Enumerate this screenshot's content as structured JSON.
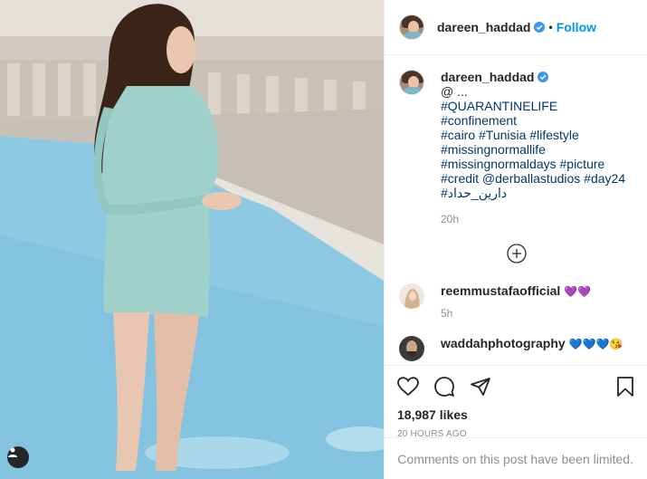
{
  "post": {
    "username": "dareen_haddad",
    "follow_label": "Follow",
    "separator": "•"
  },
  "caption": {
    "username": "dareen_haddad",
    "lines": [
      {
        "text": "@ ...",
        "hashtag": false
      },
      {
        "text": "#QUARANTINELIFE #confinement",
        "hashtag": true
      },
      {
        "text": "#cairo #Tunisia #lifestyle",
        "hashtag": true
      },
      {
        "text": "#missingnormallife",
        "hashtag": true
      },
      {
        "text": "#missingnormaldays #picture",
        "hashtag": true
      },
      {
        "text": "#credit @derballastudios #day24",
        "hashtag": true
      },
      {
        "text": "#دارين_حداد",
        "hashtag": true
      }
    ],
    "time": "20h"
  },
  "comments": [
    {
      "username": "reemmustafaofficial",
      "emoji": "💜💜",
      "time": "5h"
    },
    {
      "username": "waddahphotography",
      "emoji": "💙💙💙😘",
      "time": ""
    }
  ],
  "actions": {
    "likes": "18,987 likes",
    "posted_ago": "20 HOURS AGO",
    "comments_limited": "Comments on this post have been limited."
  },
  "icons": [
    "heart-icon",
    "comment-icon",
    "share-icon",
    "save-icon",
    "load-more-icon",
    "user-tag-icon",
    "verified-badge-icon"
  ],
  "colors": {
    "link": "#0095f6",
    "hashtag": "#00376b",
    "muted": "#8e8e8e",
    "verified": "#3897f0"
  }
}
